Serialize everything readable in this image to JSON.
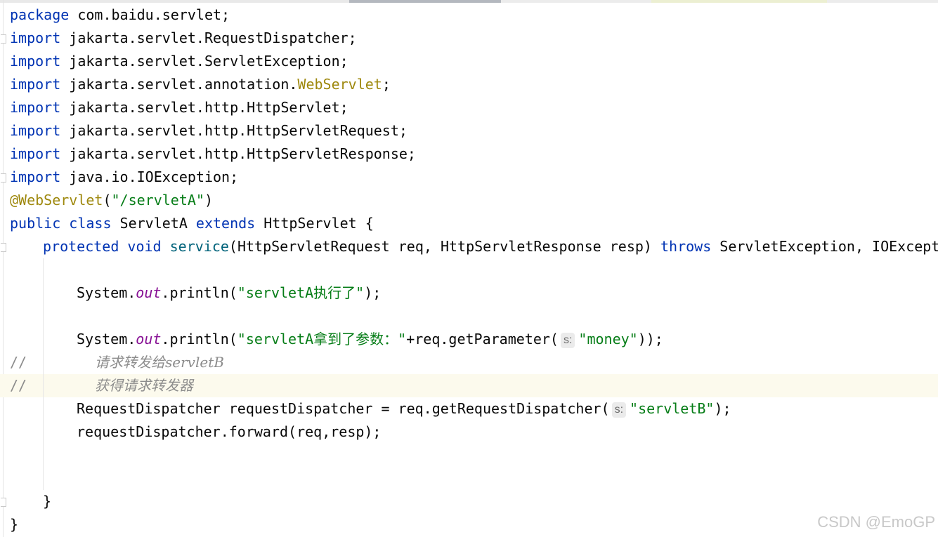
{
  "code": {
    "l1": {
      "kw": "package",
      "rest": " com.baidu.servlet;"
    },
    "l2": {
      "kw": "import",
      "rest": " jakarta.servlet.RequestDispatcher;"
    },
    "l3": {
      "kw": "import",
      "rest": " jakarta.servlet.ServletException;"
    },
    "l4": {
      "kw": "import",
      "mid": " jakarta.servlet.annotation.",
      "ann": "WebServlet",
      "end": ";"
    },
    "l5": {
      "kw": "import",
      "rest": " jakarta.servlet.http.HttpServlet;"
    },
    "l6": {
      "kw": "import",
      "rest": " jakarta.servlet.http.HttpServletRequest;"
    },
    "l7": {
      "kw": "import",
      "rest": " jakarta.servlet.http.HttpServletResponse;"
    },
    "l8": {
      "kw": "import",
      "rest": " java.io.IOException;"
    },
    "l9": {
      "ann": "@WebServlet",
      "open": "(",
      "str": "\"/servletA\"",
      "close": ")"
    },
    "l10": {
      "kw1": "public",
      "kw2": " class",
      "mid1": " ServletA ",
      "kw3": "extends",
      "end": " HttpServlet {"
    },
    "l11": {
      "kw1": "protected",
      "kw2": " void",
      "method": " service",
      "params": "(HttpServletRequest req, HttpServletResponse resp) ",
      "kw3": "throws",
      "end": " ServletException, IOException {"
    },
    "l13": {
      "pre": "System.",
      "field": "out",
      "mid": ".println(",
      "str": "\"servletA执行了\"",
      "end": ");"
    },
    "l15": {
      "pre": "System.",
      "field": "out",
      "mid": ".println(",
      "str": "\"servletA拿到了参数：\"",
      "mid2": "+req.getParameter(",
      "hint": "s:",
      "arg": "\"money\"",
      "end": "));"
    },
    "l16": {
      "slashes": "//",
      "text": "请求转发给servletB"
    },
    "l17": {
      "slashes": "//",
      "text": "获得请求转发器"
    },
    "l18": {
      "pre": "RequestDispatcher requestDispatcher = req.getRequestDispatcher(",
      "hint": "s:",
      "arg": "\"servletB\"",
      "end": ");"
    },
    "l19": {
      "text": "requestDispatcher.forward(req,resp);"
    },
    "l22": {
      "text": "}"
    },
    "l23": {
      "text": "}"
    }
  },
  "watermark": "CSDN @EmoGP",
  "colors": {
    "keyword": "#0033b3",
    "annotation": "#9e880d",
    "string": "#067d17",
    "static_field": "#871094",
    "method_declaration": "#00627a",
    "comment": "#8c8c8c",
    "caret_line": "#fcfaed"
  }
}
